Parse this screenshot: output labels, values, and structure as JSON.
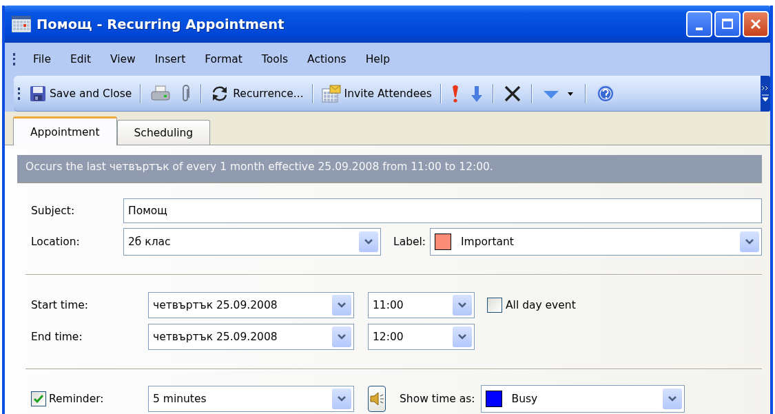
{
  "window": {
    "title": "Помощ - Recurring Appointment"
  },
  "menu": [
    {
      "label": "File"
    },
    {
      "label": "Edit"
    },
    {
      "label": "View"
    },
    {
      "label": "Insert"
    },
    {
      "label": "Format"
    },
    {
      "label": "Tools"
    },
    {
      "label": "Actions"
    },
    {
      "label": "Help"
    }
  ],
  "toolbar": {
    "save": "Save and Close",
    "recurrence": "Recurrence...",
    "invite": "Invite Attendees"
  },
  "tabs": [
    {
      "label": "Appointment",
      "selected": true
    },
    {
      "label": "Scheduling",
      "selected": false
    }
  ],
  "summary": "Occurs the last четвъртък of every 1 month effective 25.09.2008 from 11:00 to 12:00.",
  "subject": {
    "label": "Subject:",
    "value": "Помощ"
  },
  "location": {
    "label": "Location:",
    "value": "2б клас"
  },
  "label": {
    "label": "Label:",
    "value": "Important",
    "color": "#fa8c78"
  },
  "start": {
    "label": "Start time:",
    "date": "четвъртък 25.09.2008",
    "time": "11:00"
  },
  "end": {
    "label": "End time:",
    "date": "четвъртък 25.09.2008",
    "time": "12:00"
  },
  "all_day": {
    "label": "All day event",
    "checked": false
  },
  "reminder": {
    "label": "Reminder:",
    "checked": true,
    "value": "5 minutes"
  },
  "show_time_as": {
    "label": "Show time as:",
    "value": "Busy",
    "color": "#0000ff"
  }
}
